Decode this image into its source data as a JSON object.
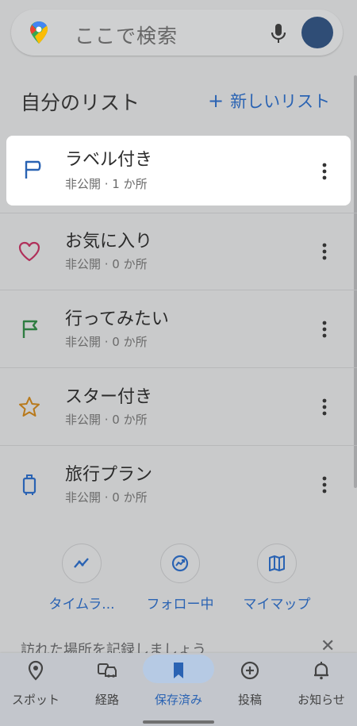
{
  "search": {
    "placeholder": "ここで検索"
  },
  "lists_header": {
    "title": "自分のリスト",
    "new_list": "新しいリスト"
  },
  "lists": [
    {
      "title": "ラベル付き",
      "subtitle": "非公開 · 1 か所",
      "icon": "label-flag-icon",
      "color": "#2a63b3"
    },
    {
      "title": "お気に入り",
      "subtitle": "非公開 · 0 か所",
      "icon": "heart-icon",
      "color": "#b0305a"
    },
    {
      "title": "行ってみたい",
      "subtitle": "非公開 · 0 か所",
      "icon": "flag-icon",
      "color": "#2f7d42"
    },
    {
      "title": "スター付き",
      "subtitle": "非公開 · 0 か所",
      "icon": "star-icon",
      "color": "#b8791b"
    },
    {
      "title": "旅行プラン",
      "subtitle": "非公開 · 0 か所",
      "icon": "suitcase-icon",
      "color": "#2a63b3"
    }
  ],
  "shortcuts": [
    {
      "label": "タイムラ...",
      "icon": "timeline-icon"
    },
    {
      "label": "フォロー中",
      "icon": "following-icon"
    },
    {
      "label": "マイマップ",
      "icon": "map-icon"
    }
  ],
  "partial_text": "訪れた場所を記録しましょう",
  "bottom_nav": [
    {
      "label": "スポット",
      "icon": "pin-icon",
      "active": false
    },
    {
      "label": "経路",
      "icon": "commute-icon",
      "active": false
    },
    {
      "label": "保存済み",
      "icon": "bookmark-icon",
      "active": true
    },
    {
      "label": "投稿",
      "icon": "add-circle-icon",
      "active": false
    },
    {
      "label": "お知らせ",
      "icon": "bell-icon",
      "active": false
    }
  ],
  "colors": {
    "accent": "#2a63b3",
    "background": "#c9cacb",
    "highlight": "#ffffff"
  }
}
